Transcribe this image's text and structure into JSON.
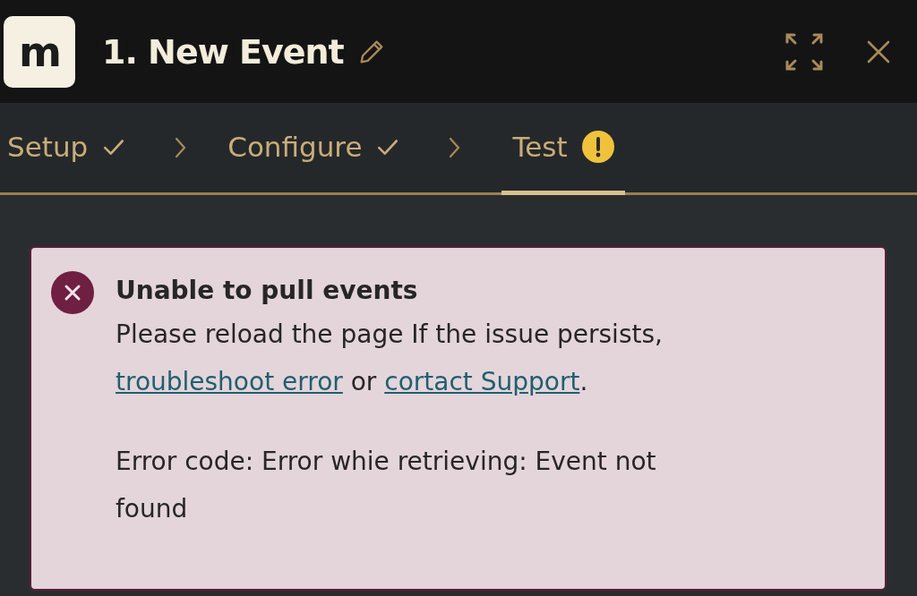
{
  "header": {
    "logo": "m",
    "title": "1. New Event"
  },
  "steps": [
    {
      "label": "Setup",
      "done": true,
      "warning": false,
      "selected": false
    },
    {
      "label": "Configure",
      "done": true,
      "warning": false,
      "selected": false
    },
    {
      "label": "Test",
      "done": false,
      "warning": true,
      "selected": true
    }
  ],
  "alert": {
    "kind": "error",
    "title": "Unable to pull events",
    "message": [
      {
        "kind": "text",
        "text": "Please reload the page If the issue persists, "
      },
      {
        "kind": "link",
        "text": "troubleshoot error"
      },
      {
        "kind": "text",
        "text": " or "
      },
      {
        "kind": "link",
        "text": "cortact Support"
      },
      {
        "kind": "text",
        "text": "."
      }
    ],
    "detail": "Error code: Error whie retrieving: Event not found"
  }
}
